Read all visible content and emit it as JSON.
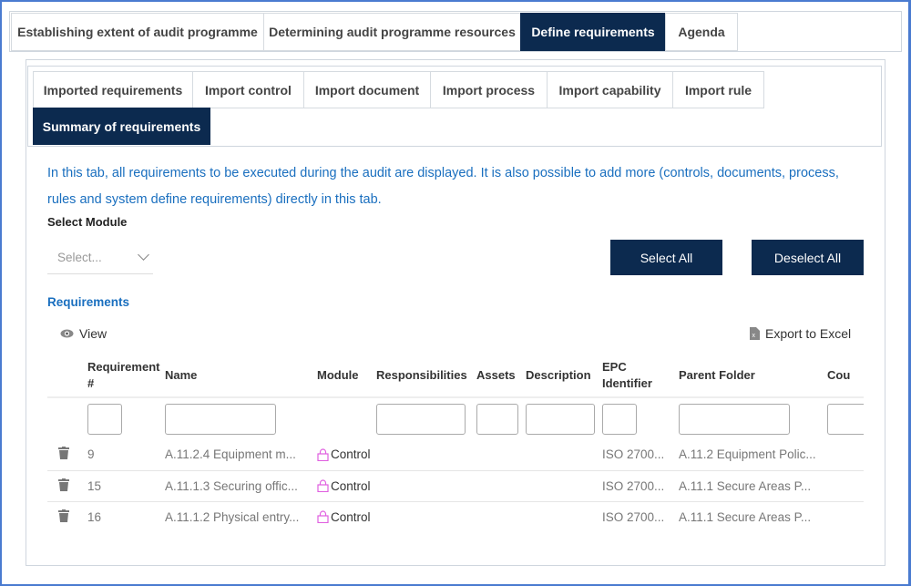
{
  "top_tabs": [
    {
      "label": "Establishing extent of audit programme"
    },
    {
      "label": "Determining audit programme resources"
    },
    {
      "label": "Define requirements",
      "active": true
    },
    {
      "label": "Agenda"
    }
  ],
  "sub_tabs": [
    {
      "label": "Imported requirements"
    },
    {
      "label": "Import control"
    },
    {
      "label": "Import document"
    },
    {
      "label": "Import process"
    },
    {
      "label": "Import capability"
    },
    {
      "label": "Import rule"
    },
    {
      "label": "Summary of requirements",
      "active": true
    }
  ],
  "info_text": "In this tab, all requirements to be executed during the audit are displayed. It is also possible to add more (controls, documents, process, rules and system define requirements) directly in this tab.",
  "select_module": {
    "label": "Select Module",
    "placeholder": "Select..."
  },
  "buttons": {
    "select_all": "Select All",
    "deselect_all": "Deselect All"
  },
  "requirements_heading": "Requirements",
  "toolbar": {
    "view": "View",
    "export": "Export to Excel"
  },
  "colors": {
    "accent": "#0c2a4f",
    "info": "#1a6fbf",
    "lock": "#e060e0"
  },
  "table": {
    "columns": [
      "Requirement #",
      "Name",
      "Module",
      "Responsibilities",
      "Assets",
      "Description",
      "EPC Identifier",
      "Parent Folder",
      "Cou"
    ],
    "rows": [
      {
        "id": "9",
        "name": "A.11.2.4 Equipment m...",
        "module": "Control",
        "epc": "ISO 2700...",
        "parent": "A.11.2 Equipment Polic..."
      },
      {
        "id": "15",
        "name": "A.11.1.3 Securing offic...",
        "module": "Control",
        "epc": "ISO 2700...",
        "parent": "A.11.1 Secure Areas P..."
      },
      {
        "id": "16",
        "name": "A.11.1.2 Physical entry...",
        "module": "Control",
        "epc": "ISO 2700...",
        "parent": "A.11.1 Secure Areas P..."
      }
    ]
  }
}
